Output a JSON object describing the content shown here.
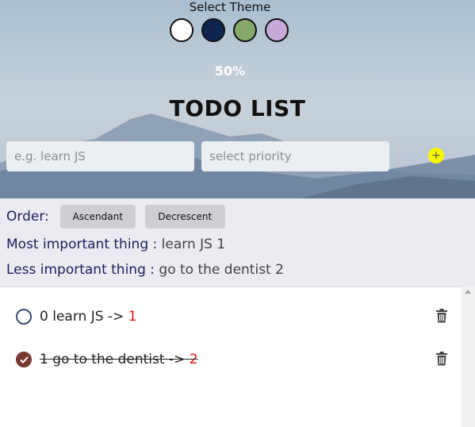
{
  "theme": {
    "label": "Select Theme",
    "swatches": [
      {
        "name": "white",
        "color": "#ffffff"
      },
      {
        "name": "navy",
        "color": "#0f2550"
      },
      {
        "name": "green",
        "color": "#86a86a"
      },
      {
        "name": "lavender",
        "color": "#c7a9da"
      }
    ]
  },
  "progress": {
    "label": "50%",
    "value": 0.5
  },
  "title": "TODO LIST",
  "inputs": {
    "todo_placeholder": "e.g. learn JS",
    "priority_placeholder": "select priority",
    "add_icon": "+"
  },
  "order": {
    "label": "Order:",
    "ascending": "Ascendant",
    "descending": "Decrescent"
  },
  "summary": {
    "most_label": "Most important thing :",
    "most_value": "learn JS 1",
    "less_label": "Less important thing :",
    "less_value": "go to the dentist 2"
  },
  "todos": [
    {
      "index": "0",
      "text": "learn JS",
      "arrow": "->",
      "priority": "1",
      "done": false
    },
    {
      "index": "1",
      "text": "go to the dentist ",
      "arrow": "->",
      "priority": "2",
      "done": true
    }
  ],
  "colors": {
    "accent_yellow": "#f7f700",
    "label_navy": "#1b1f5c",
    "priority_red": "#e01010",
    "done_check": "#7a3a32"
  }
}
